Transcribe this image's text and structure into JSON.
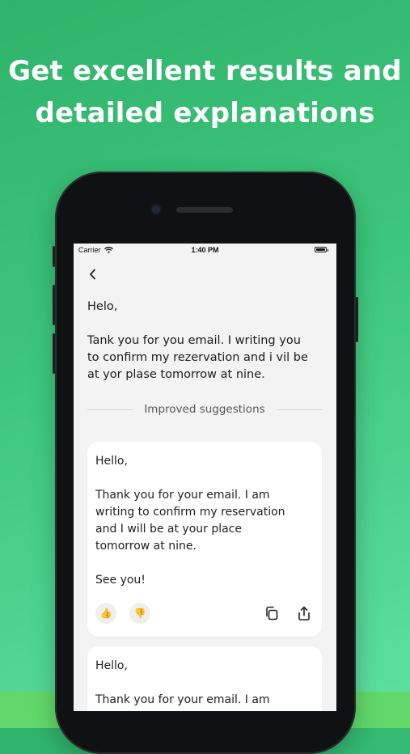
{
  "headline": {
    "line1": "Get excellent results and",
    "line2": "detailed explanations"
  },
  "status_bar": {
    "carrier": "Carrier",
    "time": "1:40 PM"
  },
  "original": {
    "text": "Helo,\n\nTank you for you email. I writing you\nto confirm my rezervation and i vil be\nat yor plase tomorrow at nine."
  },
  "divider": {
    "label": "Improved suggestions"
  },
  "suggestions": [
    {
      "text": "Hello,\n\nThank you for your email. I am\nwriting to confirm my reservation\nand I will be at your place\ntomorrow at nine.\n\nSee you!",
      "like_icon": "👍",
      "dislike_icon": "👎"
    },
    {
      "text": "Hello,\n\nThank you for your email. I am"
    }
  ],
  "colors": {
    "background_start": "#2fb36a",
    "background_end": "#5fe0a3",
    "bottom_band": "#62d86a",
    "screen": "#f3f3f3",
    "card": "#ffffff"
  }
}
